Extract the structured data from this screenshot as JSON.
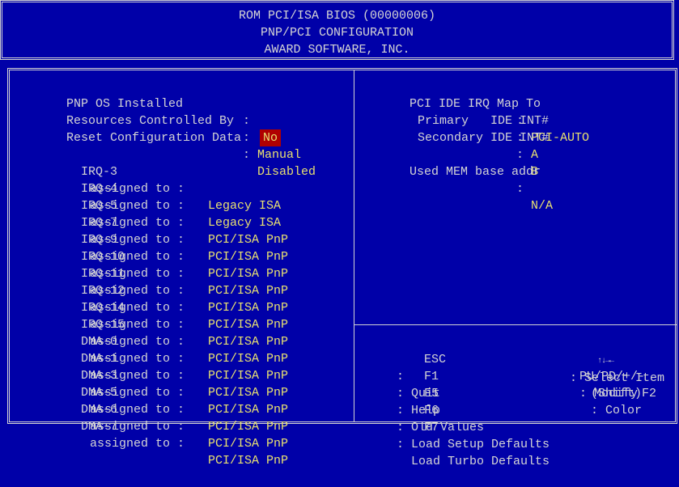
{
  "header": {
    "line1": "ROM PCI/ISA BIOS (00000006)",
    "line2": "PNP/PCI CONFIGURATION",
    "line3": "AWARD SOFTWARE, INC."
  },
  "left": {
    "pnp_os": {
      "label": "PNP OS Installed",
      "sep": ":",
      "value": "No"
    },
    "resources": {
      "label": "Resources Controlled By",
      "sep": ":",
      "value": "Manual"
    },
    "reset": {
      "label": "Reset Configuration Data",
      "sep": ":",
      "value": "Disabled"
    },
    "assignments": [
      {
        "name": "IRQ-3",
        "text": "assigned to :",
        "value": "Legacy ISA"
      },
      {
        "name": "IRQ-4",
        "text": "assigned to :",
        "value": "Legacy ISA"
      },
      {
        "name": "IRQ-5",
        "text": "assigned to :",
        "value": "PCI/ISA PnP"
      },
      {
        "name": "IRQ-7",
        "text": "assigned to :",
        "value": "PCI/ISA PnP"
      },
      {
        "name": "IRQ-9",
        "text": "assigned to :",
        "value": "PCI/ISA PnP"
      },
      {
        "name": "IRQ-10",
        "text": "assigned to :",
        "value": "PCI/ISA PnP"
      },
      {
        "name": "IRQ-11",
        "text": "assigned to :",
        "value": "PCI/ISA PnP"
      },
      {
        "name": "IRQ-12",
        "text": "assigned to :",
        "value": "PCI/ISA PnP"
      },
      {
        "name": "IRQ-14",
        "text": "assigned to :",
        "value": "PCI/ISA PnP"
      },
      {
        "name": "IRQ-15",
        "text": "assigned to :",
        "value": "PCI/ISA PnP"
      },
      {
        "name": "DMA-0",
        "text": "assigned to :",
        "value": "PCI/ISA PnP"
      },
      {
        "name": "DMA-1",
        "text": "assigned to :",
        "value": "PCI/ISA PnP"
      },
      {
        "name": "DMA-3",
        "text": "assigned to :",
        "value": "PCI/ISA PnP"
      },
      {
        "name": "DMA-5",
        "text": "assigned to :",
        "value": "PCI/ISA PnP"
      },
      {
        "name": "DMA-6",
        "text": "assigned to :",
        "value": "PCI/ISA PnP"
      },
      {
        "name": "DMA-7",
        "text": "assigned to :",
        "value": "PCI/ISA PnP"
      }
    ]
  },
  "right": {
    "irq_map": {
      "label": "PCI IDE IRQ Map To",
      "sep": ":",
      "value": "PCI-AUTO"
    },
    "primary": {
      "label": "Primary   IDE INT#",
      "sep": ":",
      "value": "A"
    },
    "secondary": {
      "label": "Secondary IDE INT#",
      "sep": ":",
      "value": "B"
    },
    "mem_base": {
      "label": "Used MEM base addr",
      "sep": ":",
      "value": "N/A"
    }
  },
  "help": {
    "esc": {
      "key": "ESC",
      "sep": ":",
      "desc": "Quit"
    },
    "select": {
      "arrows": "↑↓→←",
      "desc": ": Select Item"
    },
    "f1": {
      "key": "F1",
      "sep": ":",
      "desc": "Help"
    },
    "modify": {
      "keys": "PU/PD/+/-",
      "desc": ": Modify"
    },
    "f5": {
      "key": "F5",
      "sep": ":",
      "desc": "Old Values"
    },
    "color": {
      "keys": "(Shift)F2",
      "desc": ": Color"
    },
    "f6": {
      "key": "F6",
      "sep": ":",
      "desc": "Load Setup Defaults"
    },
    "f7": {
      "key": "F7",
      "sep": ":",
      "desc": "Load Turbo Defaults"
    }
  },
  "colors": {
    "background": "#0000a8",
    "text": "#d4d4d4",
    "value": "#e8e070",
    "highlight": "#b00000"
  }
}
